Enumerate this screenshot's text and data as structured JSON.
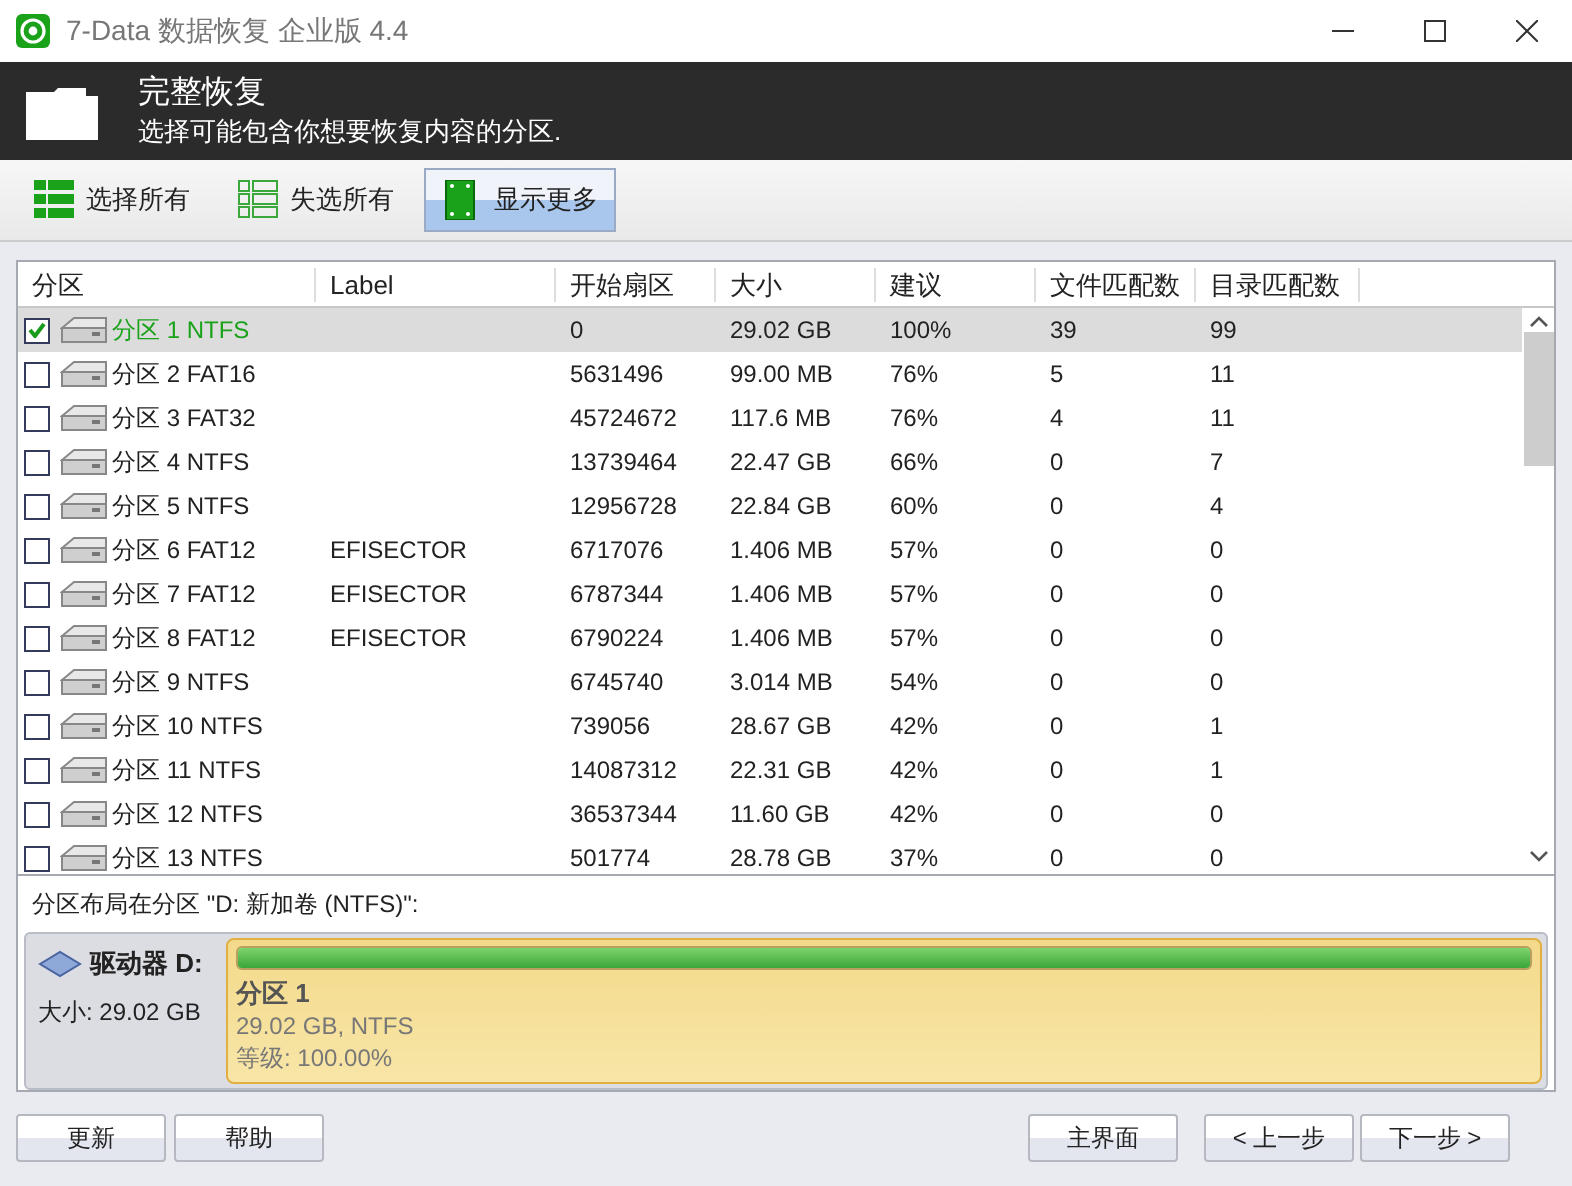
{
  "window": {
    "title": "7-Data 数据恢复 企业版 4.4"
  },
  "header": {
    "title": "完整恢复",
    "subtitle": "选择可能包含你想要恢复内容的分区."
  },
  "toolbar": [
    {
      "kind": "select-all",
      "label": "选择所有",
      "selected": false
    },
    {
      "kind": "deselect-all",
      "label": "失选所有",
      "selected": false
    },
    {
      "kind": "show-more",
      "label": "显示更多",
      "selected": true
    }
  ],
  "table": {
    "columns": [
      "分区",
      "Label",
      "开始扇区",
      "大小",
      "建议",
      "文件匹配数",
      "目录匹配数"
    ],
    "rows": [
      {
        "checked": true,
        "selected": true,
        "cells": [
          "分区 1 NTFS",
          "",
          "0",
          "29.02 GB",
          "100%",
          "39",
          "99"
        ]
      },
      {
        "checked": false,
        "selected": false,
        "cells": [
          "分区 2 FAT16",
          "",
          "5631496",
          "99.00 MB",
          "76%",
          "5",
          "11"
        ]
      },
      {
        "checked": false,
        "selected": false,
        "cells": [
          "分区 3 FAT32",
          "",
          "45724672",
          "117.6 MB",
          "76%",
          "4",
          "11"
        ]
      },
      {
        "checked": false,
        "selected": false,
        "cells": [
          "分区 4 NTFS",
          "",
          "13739464",
          "22.47 GB",
          "66%",
          "0",
          "7"
        ]
      },
      {
        "checked": false,
        "selected": false,
        "cells": [
          "分区 5 NTFS",
          "",
          "12956728",
          "22.84 GB",
          "60%",
          "0",
          "4"
        ]
      },
      {
        "checked": false,
        "selected": false,
        "cells": [
          "分区 6 FAT12",
          "EFISECTOR",
          "6717076",
          "1.406 MB",
          "57%",
          "0",
          "0"
        ]
      },
      {
        "checked": false,
        "selected": false,
        "cells": [
          "分区 7 FAT12",
          "EFISECTOR",
          "6787344",
          "1.406 MB",
          "57%",
          "0",
          "0"
        ]
      },
      {
        "checked": false,
        "selected": false,
        "cells": [
          "分区 8 FAT12",
          "EFISECTOR",
          "6790224",
          "1.406 MB",
          "57%",
          "0",
          "0"
        ]
      },
      {
        "checked": false,
        "selected": false,
        "cells": [
          "分区 9 NTFS",
          "",
          "6745740",
          "3.014 MB",
          "54%",
          "0",
          "0"
        ]
      },
      {
        "checked": false,
        "selected": false,
        "cells": [
          "分区 10 NTFS",
          "",
          "739056",
          "28.67 GB",
          "42%",
          "0",
          "1"
        ]
      },
      {
        "checked": false,
        "selected": false,
        "cells": [
          "分区 11 NTFS",
          "",
          "14087312",
          "22.31 GB",
          "42%",
          "0",
          "1"
        ]
      },
      {
        "checked": false,
        "selected": false,
        "cells": [
          "分区 12 NTFS",
          "",
          "36537344",
          "11.60 GB",
          "42%",
          "0",
          "0"
        ]
      },
      {
        "checked": false,
        "selected": false,
        "cells": [
          "分区 13 NTFS",
          "",
          "501774",
          "28.78 GB",
          "37%",
          "0",
          "0"
        ]
      }
    ]
  },
  "layout": {
    "caption": "分区布局在分区 \"D: 新加卷 (NTFS)\":",
    "drive": {
      "name": "驱动器 D:",
      "size": "大小: 29.02 GB"
    },
    "partition": {
      "name": "分区 1",
      "info": "29.02 GB, NTFS",
      "grade": "等级: 100.00%",
      "level": 1
    }
  },
  "buttons": {
    "left": [
      "更新",
      "帮助"
    ],
    "right": [
      "主界面",
      "< 上一步",
      "下一步 >"
    ]
  }
}
